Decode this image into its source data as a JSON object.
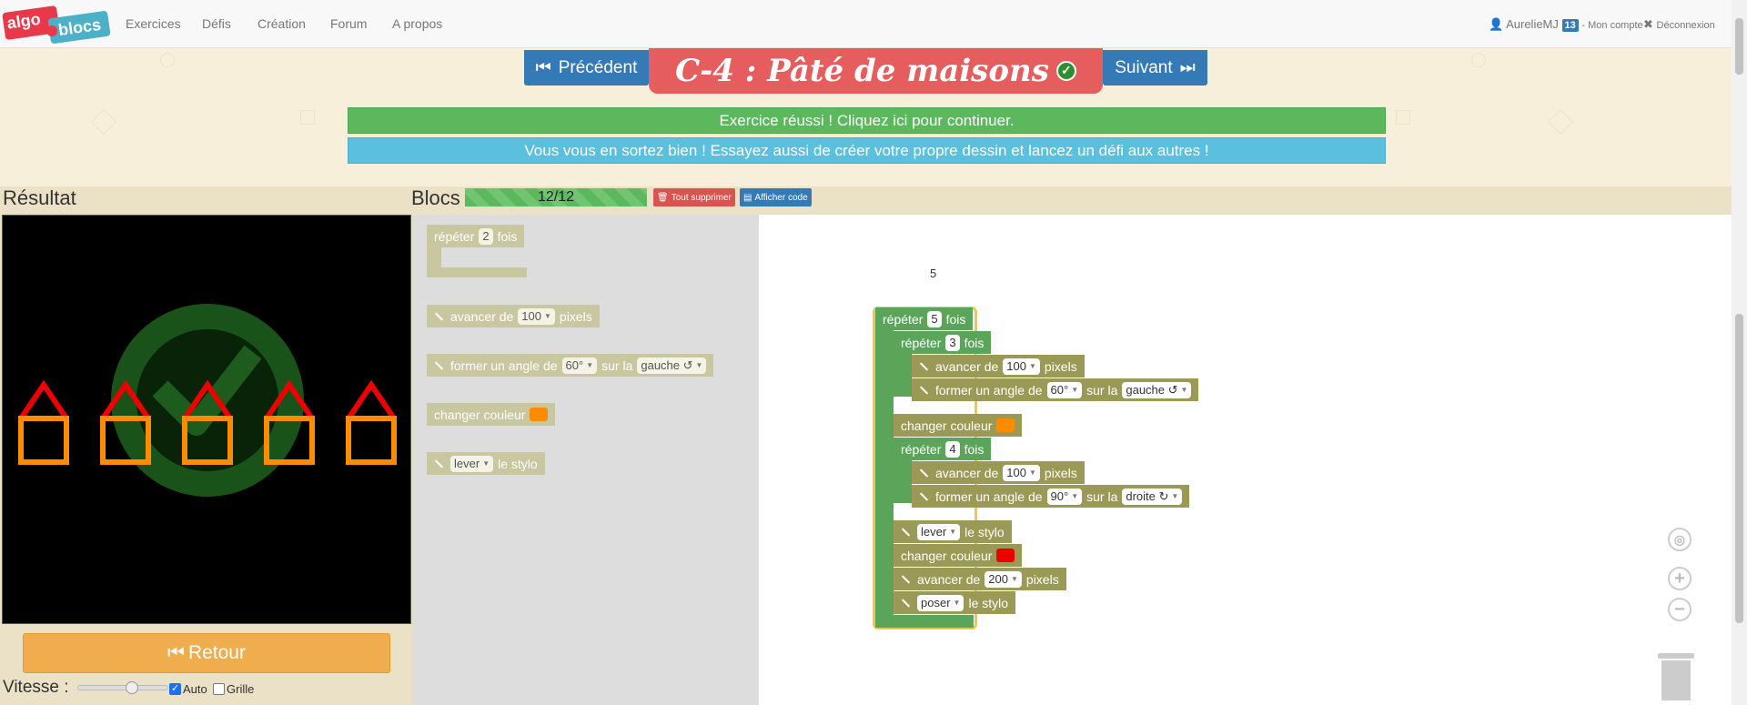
{
  "nav": {
    "logo_text_1": "algo",
    "logo_text_2": "blocs",
    "links": [
      "Exercices",
      "Défis",
      "Création",
      "Forum",
      "A propos"
    ],
    "user": "AurelieMJ",
    "badge": "13",
    "account": "- Mon compte",
    "logout": "Déconnexion"
  },
  "header": {
    "prev": "Précédent",
    "next": "Suivant",
    "title": "C-4 : Pâté de maisons",
    "success_banner": "Exercice réussi ! Cliquez ici pour continuer.",
    "info_banner": "Vous vous en sortez bien ! Essayez aussi de créer votre propre dessin et lancez un défi aux autres !"
  },
  "result": {
    "title": "Résultat",
    "retour": "Retour",
    "vitesse": "Vitesse :",
    "auto": "Auto",
    "auto_checked": true,
    "grille": "Grille",
    "grille_checked": false
  },
  "blocks_header": {
    "title": "Blocs",
    "progress": "12/12",
    "clear": "Tout supprimer",
    "show_code": "Afficher code"
  },
  "toolbox": {
    "repeat": {
      "label_before": "répéter",
      "value": "2",
      "label_after": "fois"
    },
    "forward": {
      "label_before": "avancer de",
      "value": "100",
      "label_after": "pixels"
    },
    "turn": {
      "label_before": "former un angle de",
      "value": "60°",
      "mid": "sur la",
      "dir": "gauche ↺"
    },
    "color": {
      "label": "changer couleur",
      "color": "#ff8c00"
    },
    "pen": {
      "value": "lever",
      "label_after": "le stylo"
    }
  },
  "workspace": {
    "floating_number": "5",
    "program": {
      "outer_repeat": {
        "label_before": "répéter",
        "value": "5",
        "label_after": "fois"
      },
      "inner_repeat_1": {
        "label_before": "répéter",
        "value": "3",
        "label_after": "fois"
      },
      "fwd_1": {
        "label_before": "avancer de",
        "value": "100",
        "label_after": "pixels"
      },
      "turn_1": {
        "label_before": "former un angle de",
        "value": "60°",
        "mid": "sur la",
        "dir": "gauche ↺"
      },
      "color_1": {
        "label": "changer couleur",
        "color": "#ff8c00"
      },
      "inner_repeat_2": {
        "label_before": "répéter",
        "value": "4",
        "label_after": "fois"
      },
      "fwd_2": {
        "label_before": "avancer de",
        "value": "100",
        "label_after": "pixels"
      },
      "turn_2": {
        "label_before": "former un angle de",
        "value": "90°",
        "mid": "sur la",
        "dir": "droite ↻"
      },
      "pen_up": {
        "value": "lever",
        "label_after": "le stylo"
      },
      "color_2": {
        "label": "changer couleur",
        "color": "#ee0000"
      },
      "fwd_3": {
        "label_before": "avancer de",
        "value": "200",
        "label_after": "pixels"
      },
      "pen_down": {
        "value": "poser",
        "label_after": "le stylo"
      }
    }
  },
  "colors": {
    "accent_blue": "#337ab7",
    "title_red": "#e55d5d",
    "success_green": "#5cb85c",
    "info_blue": "#5bc0de",
    "retour_orange": "#f0ad4e",
    "loop_green": "#5ba55b",
    "pen_olive": "#9a9a56"
  }
}
